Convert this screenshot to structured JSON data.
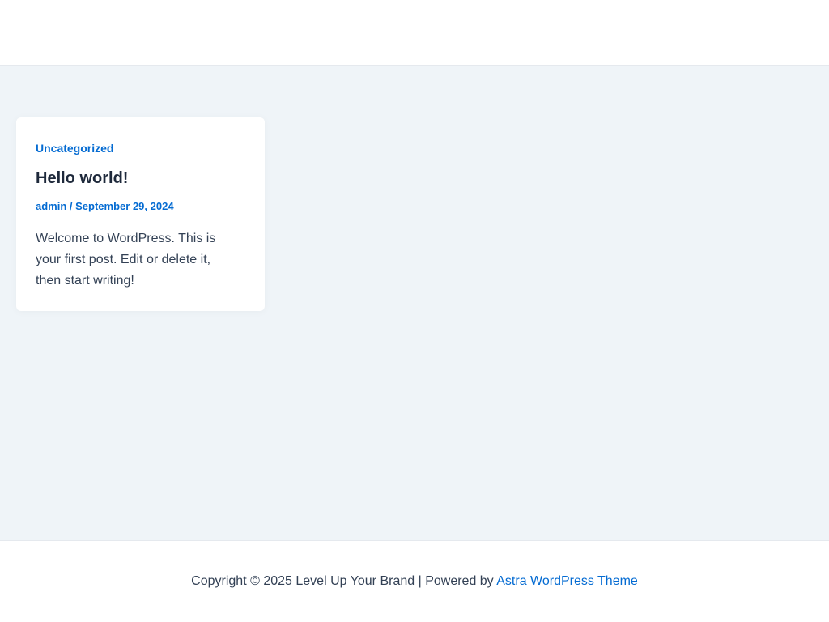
{
  "post": {
    "category": "Uncategorized",
    "title": "Hello world!",
    "author": "admin",
    "separator": " / ",
    "date": "September 29, 2024",
    "excerpt": "Welcome to WordPress. This is your first post. Edit or delete it, then start writing!"
  },
  "footer": {
    "copyright": "Copyright © 2025 Level Up Your Brand | Powered by ",
    "theme_link": "Astra WordPress Theme"
  },
  "colors": {
    "accent": "#046bd2",
    "heading": "#1e293b",
    "text": "#334155",
    "content_background": "#eff4f8"
  }
}
